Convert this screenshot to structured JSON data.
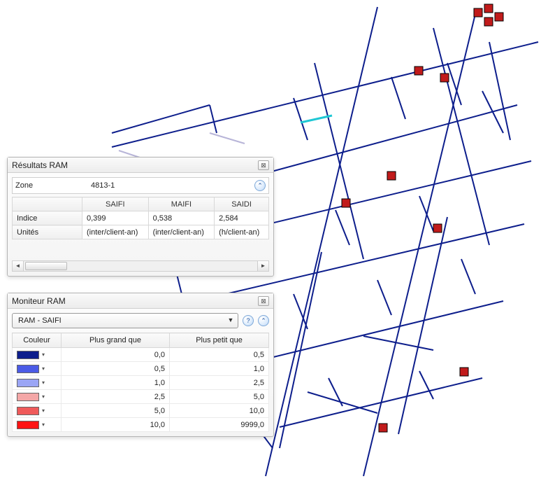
{
  "results_panel": {
    "title": "Résultats RAM",
    "zone_label": "Zone",
    "zone_value": "4813-1",
    "columns": [
      "SAIFI",
      "MAIFI",
      "SAIDI"
    ],
    "rows": [
      {
        "header": "Indice",
        "values": [
          "0,399",
          "0,538",
          "2,584"
        ]
      },
      {
        "header": "Unités",
        "values": [
          "(inter/client-an)",
          "(inter/client-an)",
          "(h/client-an)"
        ]
      }
    ]
  },
  "monitor_panel": {
    "title": "Moniteur RAM",
    "dropdown_value": "RAM - SAIFI",
    "columns": {
      "color": "Couleur",
      "greater": "Plus grand que",
      "less": "Plus petit que"
    },
    "legend": [
      {
        "color": "#0d1e8c",
        "greater": "0,0",
        "less": "0,5"
      },
      {
        "color": "#4b5be6",
        "greater": "0,5",
        "less": "1,0"
      },
      {
        "color": "#9aa5f5",
        "greater": "1,0",
        "less": "2,5"
      },
      {
        "color": "#f4a7a7",
        "greater": "2,5",
        "less": "5,0"
      },
      {
        "color": "#ef5a5a",
        "greater": "5,0",
        "less": "10,0"
      },
      {
        "color": "#ff1414",
        "greater": "10,0",
        "less": "9999,0"
      }
    ]
  },
  "icons": {
    "close": "⊠",
    "collapse": "⌃",
    "help": "?",
    "dd_arrow": "▼",
    "sb_left": "◄",
    "sb_right": "►",
    "swatch_arrow": "▾"
  }
}
